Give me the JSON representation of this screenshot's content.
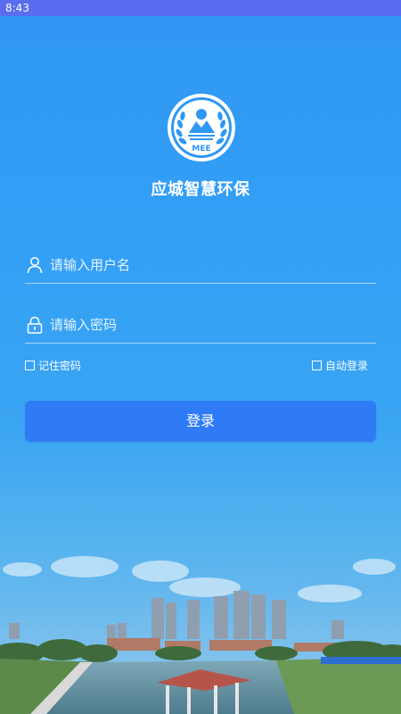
{
  "status_bar": {
    "time": "8:43"
  },
  "app": {
    "title": "应城智慧环保",
    "logo_text": "MEE"
  },
  "login_form": {
    "username_placeholder": "请输入用户名",
    "password_placeholder": "请输入密码",
    "remember_password_label": "记住密码",
    "auto_login_label": "自动登录",
    "login_button_label": "登录"
  },
  "icons": {
    "username": "user-icon",
    "password": "lock-icon",
    "logo": "mee-emblem-icon"
  },
  "colors": {
    "background_top": "#2f97f4",
    "status_bar": "#5a6cf0",
    "button": "#2f7bf5",
    "text": "#ffffff"
  }
}
